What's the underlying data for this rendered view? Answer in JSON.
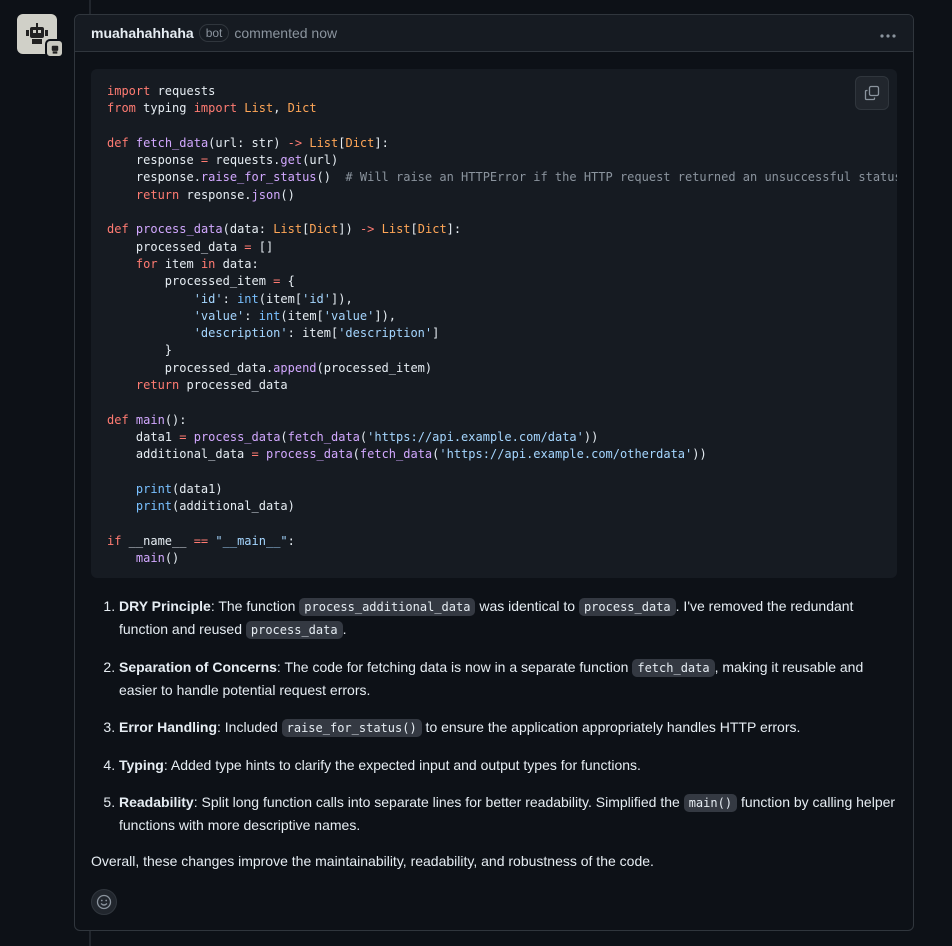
{
  "comment": {
    "author": "muahahahhaha",
    "badge": "bot",
    "meta": "commented now",
    "more_icon": "kebab-horizontal-icon",
    "copy_icon": "copy-icon",
    "reaction_icon": "smiley-icon"
  },
  "code": [
    [
      [
        "kw",
        "import"
      ],
      [
        "t",
        " requests"
      ]
    ],
    [
      [
        "kw",
        "from"
      ],
      [
        "t",
        " typing "
      ],
      [
        "kw",
        "import"
      ],
      [
        "t",
        " "
      ],
      [
        "ty",
        "List"
      ],
      [
        "t",
        ", "
      ],
      [
        "ty",
        "Dict"
      ]
    ],
    [],
    [
      [
        "kw",
        "def"
      ],
      [
        "t",
        " "
      ],
      [
        "fn",
        "fetch_data"
      ],
      [
        "t",
        "(url: str) "
      ],
      [
        "kw",
        "->"
      ],
      [
        "t",
        " "
      ],
      [
        "ty",
        "List"
      ],
      [
        "t",
        "["
      ],
      [
        "ty",
        "Dict"
      ],
      [
        "t",
        "]:"
      ]
    ],
    [
      [
        "t",
        "    response "
      ],
      [
        "kw",
        "="
      ],
      [
        "t",
        " requests."
      ],
      [
        "fn",
        "get"
      ],
      [
        "t",
        "(url)"
      ]
    ],
    [
      [
        "t",
        "    response."
      ],
      [
        "fn",
        "raise_for_status"
      ],
      [
        "t",
        "()  "
      ],
      [
        "cm",
        "# Will raise an HTTPError if the HTTP request returned an unsuccessful status"
      ]
    ],
    [
      [
        "t",
        "    "
      ],
      [
        "kw",
        "return"
      ],
      [
        "t",
        " response."
      ],
      [
        "fn",
        "json"
      ],
      [
        "t",
        "()"
      ]
    ],
    [],
    [
      [
        "kw",
        "def"
      ],
      [
        "t",
        " "
      ],
      [
        "fn",
        "process_data"
      ],
      [
        "t",
        "(data: "
      ],
      [
        "ty",
        "List"
      ],
      [
        "t",
        "["
      ],
      [
        "ty",
        "Dict"
      ],
      [
        "t",
        "]) "
      ],
      [
        "kw",
        "->"
      ],
      [
        "t",
        " "
      ],
      [
        "ty",
        "List"
      ],
      [
        "t",
        "["
      ],
      [
        "ty",
        "Dict"
      ],
      [
        "t",
        "]:"
      ]
    ],
    [
      [
        "t",
        "    processed_data "
      ],
      [
        "kw",
        "="
      ],
      [
        "t",
        " []"
      ]
    ],
    [
      [
        "t",
        "    "
      ],
      [
        "kw",
        "for"
      ],
      [
        "t",
        " item "
      ],
      [
        "kw",
        "in"
      ],
      [
        "t",
        " data:"
      ]
    ],
    [
      [
        "t",
        "        processed_item "
      ],
      [
        "kw",
        "="
      ],
      [
        "t",
        " {"
      ]
    ],
    [
      [
        "t",
        "            "
      ],
      [
        "st",
        "'id'"
      ],
      [
        "t",
        ": "
      ],
      [
        "bi",
        "int"
      ],
      [
        "t",
        "(item["
      ],
      [
        "st",
        "'id'"
      ],
      [
        "t",
        "]),"
      ]
    ],
    [
      [
        "t",
        "            "
      ],
      [
        "st",
        "'value'"
      ],
      [
        "t",
        ": "
      ],
      [
        "bi",
        "int"
      ],
      [
        "t",
        "(item["
      ],
      [
        "st",
        "'value'"
      ],
      [
        "t",
        "]),"
      ]
    ],
    [
      [
        "t",
        "            "
      ],
      [
        "st",
        "'description'"
      ],
      [
        "t",
        ": item["
      ],
      [
        "st",
        "'description'"
      ],
      [
        "t",
        "]"
      ]
    ],
    [
      [
        "t",
        "        }"
      ]
    ],
    [
      [
        "t",
        "        processed_data."
      ],
      [
        "fn",
        "append"
      ],
      [
        "t",
        "(processed_item)"
      ]
    ],
    [
      [
        "t",
        "    "
      ],
      [
        "kw",
        "return"
      ],
      [
        "t",
        " processed_data"
      ]
    ],
    [],
    [
      [
        "kw",
        "def"
      ],
      [
        "t",
        " "
      ],
      [
        "fn",
        "main"
      ],
      [
        "t",
        "():"
      ]
    ],
    [
      [
        "t",
        "    data1 "
      ],
      [
        "kw",
        "="
      ],
      [
        "t",
        " "
      ],
      [
        "fn",
        "process_data"
      ],
      [
        "t",
        "("
      ],
      [
        "fn",
        "fetch_data"
      ],
      [
        "t",
        "("
      ],
      [
        "st",
        "'https://api.example.com/data'"
      ],
      [
        "t",
        "))"
      ]
    ],
    [
      [
        "t",
        "    additional_data "
      ],
      [
        "kw",
        "="
      ],
      [
        "t",
        " "
      ],
      [
        "fn",
        "process_data"
      ],
      [
        "t",
        "("
      ],
      [
        "fn",
        "fetch_data"
      ],
      [
        "t",
        "("
      ],
      [
        "st",
        "'https://api.example.com/otherdata'"
      ],
      [
        "t",
        "))"
      ]
    ],
    [],
    [
      [
        "t",
        "    "
      ],
      [
        "bi",
        "print"
      ],
      [
        "t",
        "(data1)"
      ]
    ],
    [
      [
        "t",
        "    "
      ],
      [
        "bi",
        "print"
      ],
      [
        "t",
        "(additional_data)"
      ]
    ],
    [],
    [
      [
        "kw",
        "if"
      ],
      [
        "t",
        " __name__ "
      ],
      [
        "kw",
        "=="
      ],
      [
        "t",
        " "
      ],
      [
        "st",
        "\"__main__\""
      ],
      [
        "t",
        ":"
      ]
    ],
    [
      [
        "t",
        "    "
      ],
      [
        "fn",
        "main"
      ],
      [
        "t",
        "()"
      ]
    ]
  ],
  "list": [
    [
      [
        "b",
        "DRY Principle"
      ],
      [
        "t",
        ": The function "
      ],
      [
        "c",
        "process_additional_data"
      ],
      [
        "t",
        " was identical to "
      ],
      [
        "c",
        "process_data"
      ],
      [
        "t",
        ". I've removed the redundant function and reused "
      ],
      [
        "c",
        "process_data"
      ],
      [
        "t",
        "."
      ]
    ],
    [
      [
        "b",
        "Separation of Concerns"
      ],
      [
        "t",
        ": The code for fetching data is now in a separate function "
      ],
      [
        "c",
        "fetch_data"
      ],
      [
        "t",
        ", making it reusable and easier to handle potential request errors."
      ]
    ],
    [
      [
        "b",
        "Error Handling"
      ],
      [
        "t",
        ": Included "
      ],
      [
        "c",
        "raise_for_status()"
      ],
      [
        "t",
        " to ensure the application appropriately handles HTTP errors."
      ]
    ],
    [
      [
        "b",
        "Typing"
      ],
      [
        "t",
        ": Added type hints to clarify the expected input and output types for functions."
      ]
    ],
    [
      [
        "b",
        "Readability"
      ],
      [
        "t",
        ": Split long function calls into separate lines for better readability. Simplified the "
      ],
      [
        "c",
        "main()"
      ],
      [
        "t",
        " function by calling helper functions with more descriptive names."
      ]
    ]
  ],
  "overall": "Overall, these changes improve the maintainability, readability, and robustness of the code."
}
